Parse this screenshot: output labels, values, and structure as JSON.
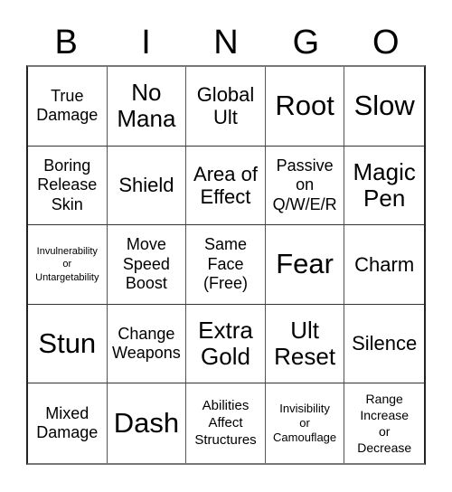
{
  "header": {
    "letters": [
      "B",
      "I",
      "N",
      "G",
      "O"
    ]
  },
  "board": {
    "rows": [
      [
        "True\nDamage",
        "No\nMana",
        "Global\nUlt",
        "Root",
        "Slow"
      ],
      [
        "Boring\nRelease\nSkin",
        "Shield",
        "Area of\nEffect",
        "Passive\non\nQ/W/E/R",
        "Magic\nPen"
      ],
      [
        "Invulnerability\nor\nUntargetability",
        "Move\nSpeed\nBoost",
        "Same\nFace\n(Free)",
        "Fear",
        "Charm"
      ],
      [
        "Stun",
        "Change\nWeapons",
        "Extra\nGold",
        "Ult\nReset",
        "Silence"
      ],
      [
        "Mixed\nDamage",
        "Dash",
        "Abilities\nAffect\nStructures",
        "Invisibility\nor\nCamouflage",
        "Range\nIncrease\nor\nDecrease"
      ]
    ]
  }
}
